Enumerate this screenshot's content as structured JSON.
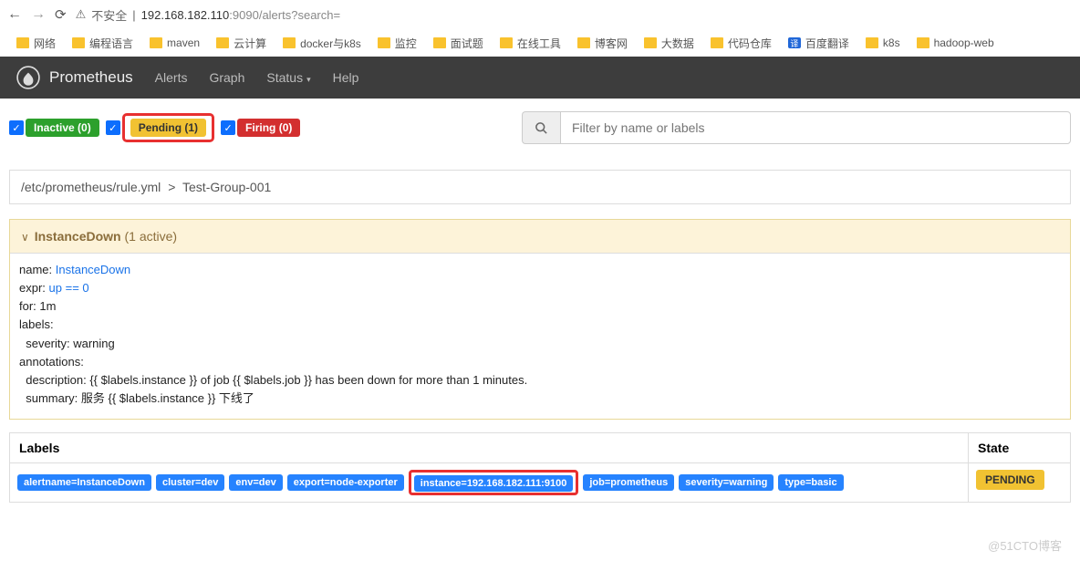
{
  "browser": {
    "insecure_label": "不安全",
    "url_host": "192.168.182.110",
    "url_port": ":9090",
    "url_path": "/alerts?search="
  },
  "bookmarks": [
    "网络",
    "编程语言",
    "maven",
    "云计算",
    "docker与k8s",
    "监控",
    "面试题",
    "在线工具",
    "博客网",
    "大数据",
    "代码仓库",
    "百度翻译",
    "k8s",
    "hadoop-web"
  ],
  "nav": {
    "brand": "Prometheus",
    "links": [
      "Alerts",
      "Graph",
      "Status",
      "Help"
    ]
  },
  "filters": {
    "inactive": "Inactive (0)",
    "pending": "Pending (1)",
    "firing": "Firing (0)"
  },
  "search": {
    "placeholder": "Filter by name or labels"
  },
  "breadcrumb": {
    "path": "/etc/prometheus/rule.yml",
    "sep": ">",
    "group": "Test-Group-001"
  },
  "rule": {
    "title": "InstanceDown",
    "active": "(1 active)",
    "name_k": "name:",
    "name_v": "InstanceDown",
    "expr_k": "expr:",
    "expr_v": "up == 0",
    "for": "for: 1m",
    "labels": "labels:",
    "severity": "  severity: warning",
    "ann": "annotations:",
    "desc": "  description: {{ $labels.instance }} of job {{ $labels.job }} has been down for more than 1 minutes.",
    "sum": "  summary: 服务 {{ $labels.instance }} 下线了"
  },
  "table": {
    "h_labels": "Labels",
    "h_state": "State",
    "labels": [
      "alertname=InstanceDown",
      "cluster=dev",
      "env=dev",
      "export=node-exporter",
      "instance=192.168.182.111:9100",
      "job=prometheus",
      "severity=warning",
      "type=basic"
    ],
    "highlight_index": 4,
    "state": "PENDING"
  },
  "watermark": "@51CTO博客"
}
